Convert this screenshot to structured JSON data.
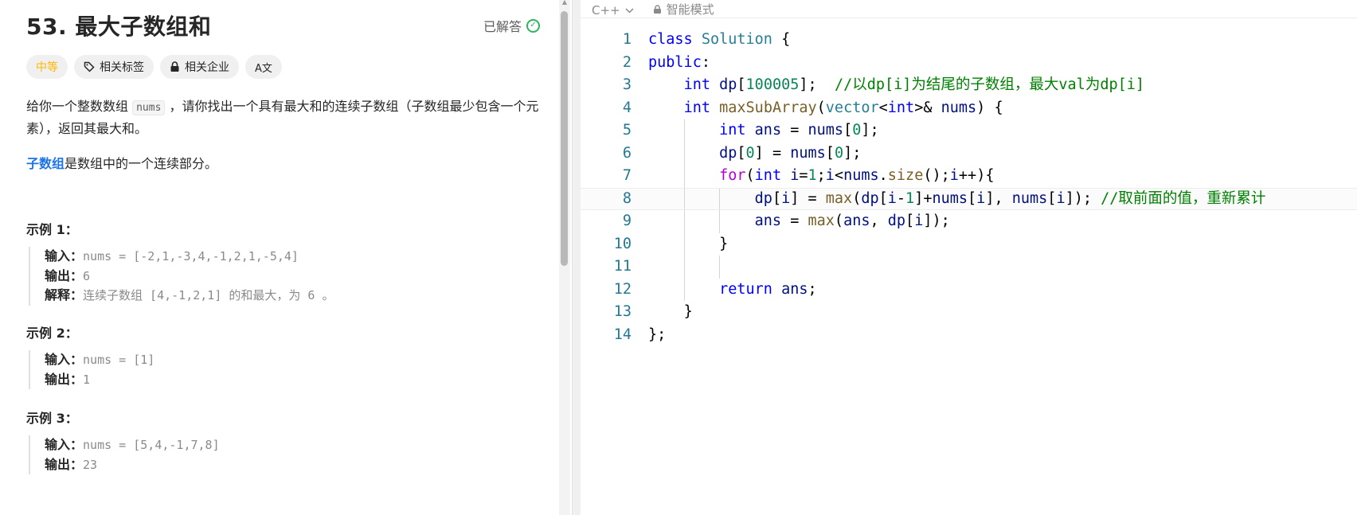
{
  "problem": {
    "title": "53. 最大子数组和",
    "status": "已解答",
    "tags": {
      "difficulty": "中等",
      "related_tags": "相关标签",
      "related_companies": "相关企业",
      "translate": "A文"
    },
    "desc_part1": "给你一个整数数组",
    "desc_code": "nums",
    "desc_part2": "，请你找出一个具有最大和的连续子数组（子数组最少包含一个元素），返回其最大和。",
    "subarray_link": "子数组",
    "subarray_rest": "是数组中的一个连续部分。",
    "examples": [
      {
        "title": "示例 1：",
        "input_label": "输入：",
        "input": "nums = [-2,1,-3,4,-1,2,1,-5,4]",
        "output_label": "输出：",
        "output": "6",
        "explain_label": "解释：",
        "explain": "连续子数组 [4,-1,2,1] 的和最大，为 6 。"
      },
      {
        "title": "示例 2：",
        "input_label": "输入：",
        "input": "nums = [1]",
        "output_label": "输出：",
        "output": "1"
      },
      {
        "title": "示例 3：",
        "input_label": "输入：",
        "input": "nums = [5,4,-1,7,8]",
        "output_label": "输出：",
        "output": "23"
      }
    ]
  },
  "editor": {
    "language": "C++",
    "mode": "智能模式",
    "line_numbers": [
      "1",
      "2",
      "3",
      "4",
      "5",
      "6",
      "7",
      "8",
      "9",
      "10",
      "11",
      "12",
      "13",
      "14"
    ],
    "code_lines": [
      "class Solution {",
      "public:",
      "    int dp[100005];  //以dp[i]为结尾的子数组，最大val为dp[i]",
      "    int maxSubArray(vector<int>& nums) {",
      "        int ans = nums[0];",
      "        dp[0] = nums[0];",
      "        for(int i=1;i<nums.size();i++){",
      "            dp[i] = max(dp[i-1]+nums[i], nums[i]); //取前面的值，重新累计",
      "            ans = max(ans, dp[i]);",
      "        }",
      "",
      "        return ans;",
      "    }",
      "};"
    ]
  }
}
